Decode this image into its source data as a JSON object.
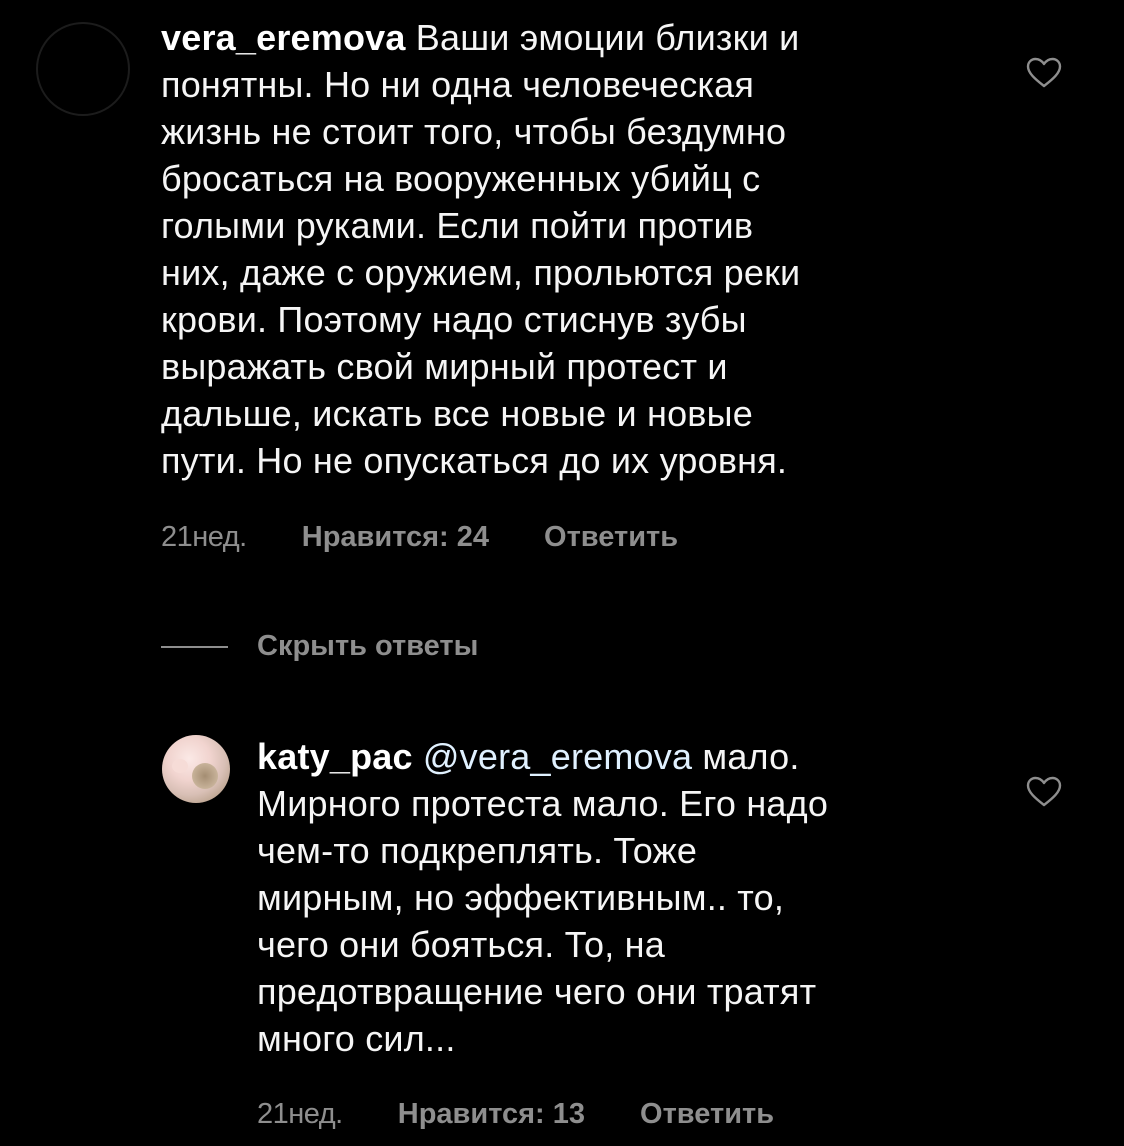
{
  "comments": [
    {
      "username": "vera_eremova",
      "text": "Ваши эмоции близки и\nпонятны. Но ни одна человеческая\nжизнь не стоит того, чтобы бездумно\nбросаться на вооруженных убийц с\nголыми руками. Если пойти против\nних, даже с оружием, прольются реки\nкрови. Поэтому надо стиснув зубы\nвыражать свой мирный протест и\nдальше, искать все новые и новые\nпути. Но не опускаться до их уровня.",
      "time": "21нед.",
      "likes": "Нравится: 24",
      "reply": "Ответить",
      "like_icon": "heart-outline-icon"
    },
    {
      "username": "katy_pac",
      "mention": "@vera_eremova",
      "text": "мало.\nМирного протеста мало. Его надо\nчем-то подкреплять. Тоже\nмирным, но эффективным.. то,\nчего они бояться. То, на\nпредотвращение чего они тратят\nмного сил...",
      "time": "21нед.",
      "likes": "Нравится: 13",
      "reply": "Ответить",
      "like_icon": "heart-outline-icon"
    }
  ],
  "thread": {
    "hide_replies_label": "Скрыть ответы"
  },
  "colors": {
    "background": "#000000",
    "text": "#f5f5f5",
    "secondary_text": "#8e8e8e",
    "mention": "#e0f1ff"
  }
}
